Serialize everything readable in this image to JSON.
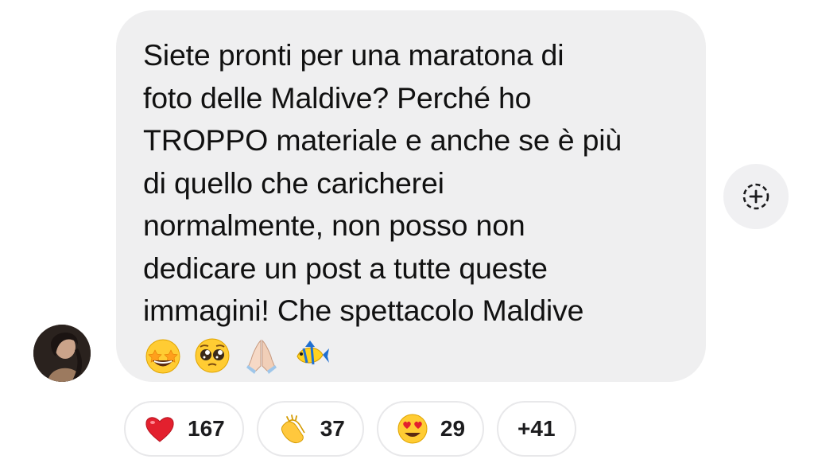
{
  "message": {
    "text": "Siete pronti per una maratona di\nfoto delle Maldive? Perché ho\nTROPPO materiale e anche se è più\ndi quello che caricherei\nnormalmente, non posso non\ndedicare un post a tutte queste\nimmagini! Che spettacolo Maldive",
    "emojis": [
      "star-struck-emoji",
      "pleading-face-emoji",
      "folded-hands-emoji",
      "tropical-fish-emoji"
    ]
  },
  "react_button": {
    "icon": "add-reaction-icon"
  },
  "reactions": [
    {
      "icon": "red-heart-emoji",
      "count": "167"
    },
    {
      "icon": "clapping-hands-emoji",
      "count": "37"
    },
    {
      "icon": "heart-eyes-emoji",
      "count": "29"
    }
  ],
  "more_reactions": {
    "label": "+41"
  },
  "colors": {
    "bubble": "#efeff0",
    "text": "#111111",
    "pill_border": "#e8e8ea"
  }
}
